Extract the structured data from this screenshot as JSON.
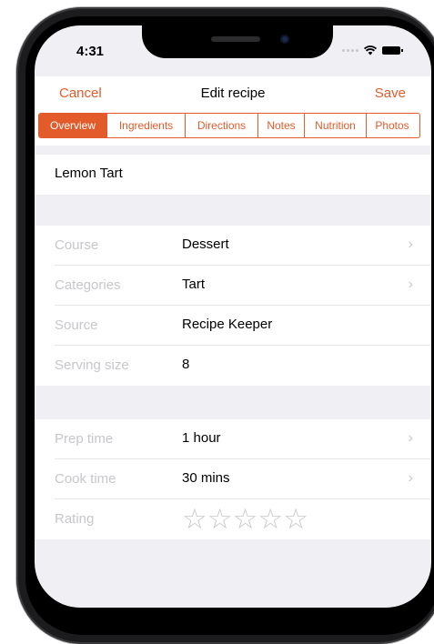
{
  "status_bar": {
    "time": "4:31"
  },
  "nav": {
    "cancel": "Cancel",
    "title": "Edit recipe",
    "save": "Save"
  },
  "tabs": [
    {
      "label": "Overview",
      "active": true
    },
    {
      "label": "Ingredients",
      "active": false
    },
    {
      "label": "Directions",
      "active": false
    },
    {
      "label": "Notes",
      "active": false
    },
    {
      "label": "Nutrition",
      "active": false
    },
    {
      "label": "Photos",
      "active": false
    }
  ],
  "recipe_name": "Lemon Tart",
  "details": {
    "course": {
      "label": "Course",
      "value": "Dessert"
    },
    "categories": {
      "label": "Categories",
      "value": "Tart"
    },
    "source": {
      "label": "Source",
      "value": "Recipe Keeper"
    },
    "serving_size": {
      "label": "Serving size",
      "value": "8"
    }
  },
  "timing": {
    "prep_time": {
      "label": "Prep time",
      "value": "1 hour"
    },
    "cook_time": {
      "label": "Cook time",
      "value": "30 mins"
    },
    "rating": {
      "label": "Rating",
      "value": 0,
      "max": 5
    }
  },
  "colors": {
    "accent": "#e35b2a",
    "grouped_background": "#efeff4",
    "placeholder_label": "#c7c7cc"
  }
}
